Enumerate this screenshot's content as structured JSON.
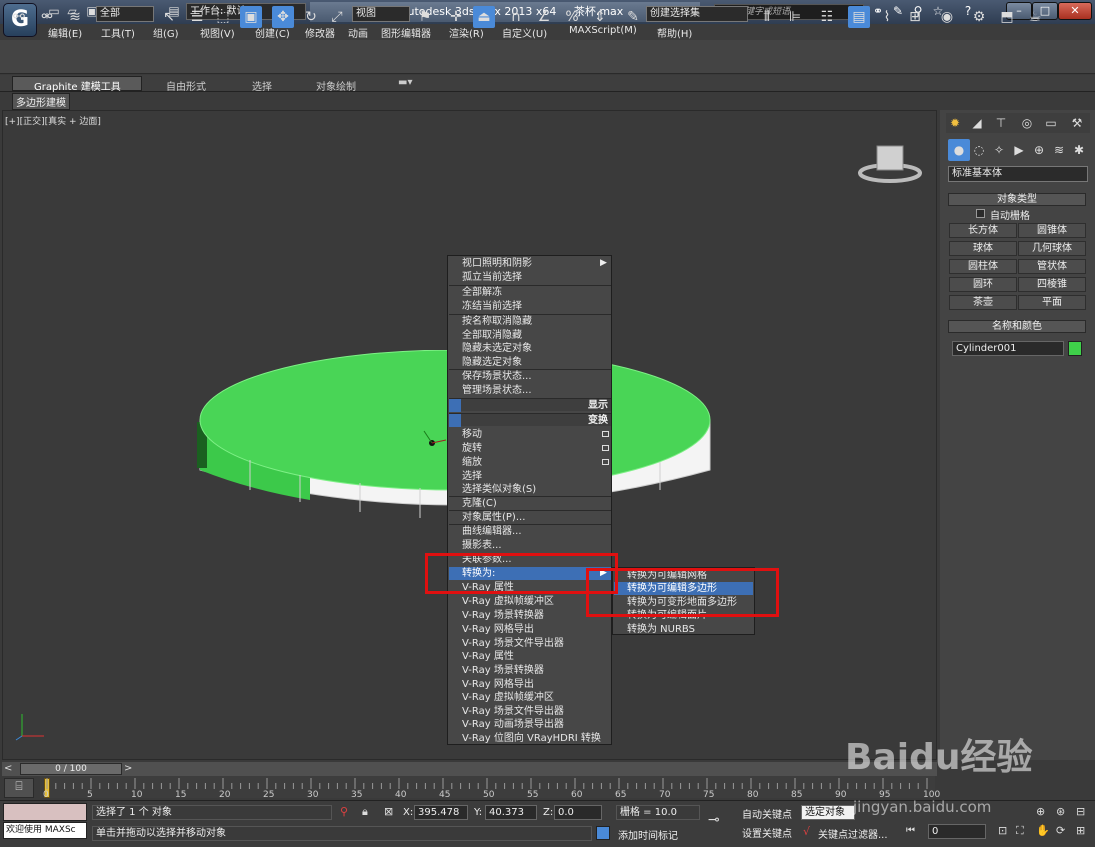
{
  "title": {
    "workspace_label": "工作台: 默认",
    "app_title": "Autodesk 3ds Max  2013 x64",
    "file_name": "茶杯.max",
    "search_placeholder": "键入关键字或短语"
  },
  "menu": [
    "编辑(E)",
    "工具(T)",
    "组(G)",
    "视图(V)",
    "创建(C)",
    "修改器",
    "动画",
    "图形编辑器",
    "渲染(R)",
    "自定义(U)",
    "MAXScript(M)",
    "帮助(H)"
  ],
  "toolbar": {
    "selection_filter": "全部",
    "ref_coord": "视图",
    "named_selection": "创建选择集"
  },
  "ribbon": {
    "tabs": [
      "Graphite 建模工具",
      "自由形式",
      "选择",
      "对象绘制"
    ],
    "subtab": "多边形建模"
  },
  "viewport": {
    "label": "[+][正交][真实 + 边面]"
  },
  "command_panel": {
    "category": "标准基本体",
    "object_type_title": "对象类型",
    "autogrid": "自动栅格",
    "buttons": [
      "长方体",
      "圆锥体",
      "球体",
      "几何球体",
      "圆柱体",
      "管状体",
      "圆环",
      "四棱锥",
      "茶壶",
      "平面"
    ],
    "name_color_title": "名称和颜色",
    "object_name": "Cylinder001",
    "object_color": "#3fd14a"
  },
  "context_menu": {
    "items_top": [
      "视口照明和阴影",
      "孤立当前选择",
      "全部解冻",
      "冻结当前选择",
      "按名称取消隐藏",
      "全部取消隐藏",
      "隐藏未选定对象",
      "隐藏选定对象",
      "保存场景状态...",
      "管理场景状态..."
    ],
    "section_display": "显示",
    "section_transform": "变换",
    "items_transform": [
      "移动",
      "旋转",
      "缩放",
      "选择",
      "选择类似对象(S)",
      "克隆(C)",
      "对象属性(P)...",
      "曲线编辑器...",
      "摄影表...",
      "关联参数..."
    ],
    "convert_to": "转换为:",
    "items_vray": [
      "V-Ray 属性",
      "V-Ray 虚拟帧缓冲区",
      "V-Ray 场景转换器",
      "V-Ray 网格导出",
      "V-Ray 场景文件导出器",
      "V-Ray 属性",
      "V-Ray 场景转换器",
      "V-Ray 网格导出",
      "V-Ray 虚拟帧缓冲区",
      "V-Ray 场景文件导出器",
      "V-Ray 动画场景导出器",
      "V-Ray 位图向 VRayHDRI 转换"
    ]
  },
  "submenu": [
    "转换为可编辑网格",
    "转换为可编辑多边形",
    "转换为可变形地面多边形",
    "转换为可编辑面片",
    "转换为 NURBS"
  ],
  "timeline": {
    "frame": "0 / 100",
    "ticks": [
      "0",
      "5",
      "10",
      "15",
      "20",
      "25",
      "30",
      "35",
      "40",
      "45",
      "50",
      "55",
      "60",
      "65",
      "70",
      "75",
      "80",
      "85",
      "90",
      "95",
      "100"
    ]
  },
  "status": {
    "welcome": "欢迎使用 MAXSc",
    "selected": "选择了 1 个 对象",
    "hint": "单击并拖动以选择并移动对象",
    "x_label": "X:",
    "x": "395.478",
    "y_label": "Y:",
    "y": "40.373",
    "z_label": "Z:",
    "z": "0.0",
    "grid": "栅格 = 10.0",
    "add_time_tag": "添加时间标记",
    "auto_key": "自动关键点",
    "selected_obj": "选定对象",
    "set_key": "设置关键点",
    "key_filters": "关键点过滤器...",
    "frame_field": "0"
  },
  "watermark": {
    "brand": "Baidu经验",
    "url": "jingyan.baidu.com"
  }
}
